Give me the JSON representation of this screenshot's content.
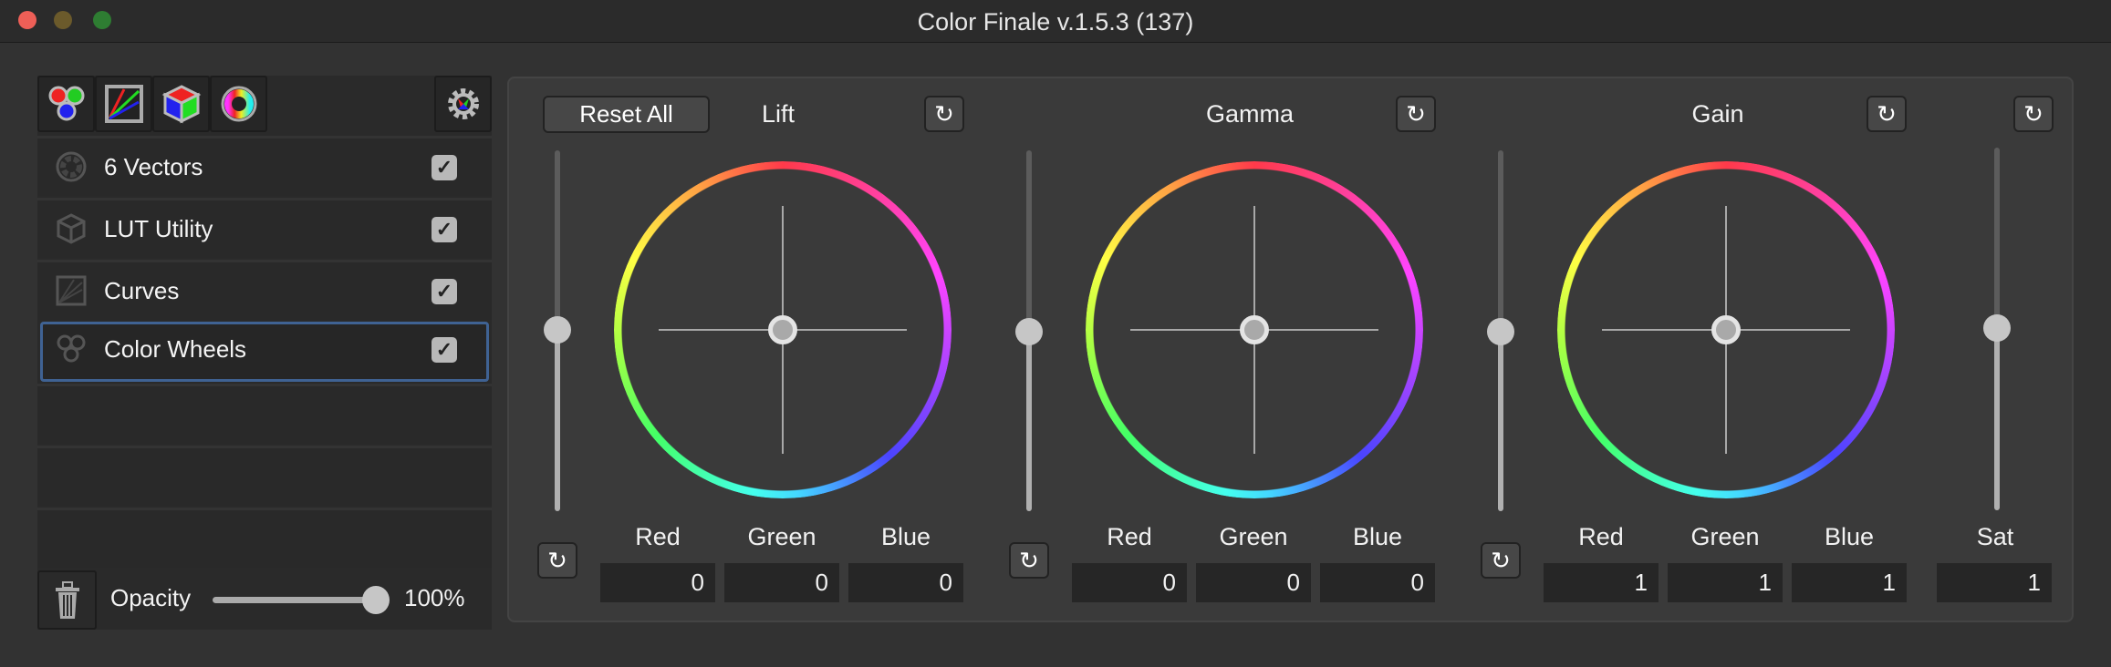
{
  "window": {
    "title": "Color Finale v.1.5.3 (137)",
    "traffic_lights": [
      "#ee5f57",
      "#6b5a2b",
      "#2e7d32"
    ]
  },
  "toolbar": {
    "buttons": [
      "color-wheels",
      "curves",
      "lut",
      "six-vectors"
    ],
    "settings": "settings"
  },
  "sidebar": {
    "items": [
      {
        "label": "6 Vectors",
        "checked": true
      },
      {
        "label": "LUT Utility",
        "checked": true
      },
      {
        "label": "Curves",
        "checked": true
      },
      {
        "label": "Color Wheels",
        "checked": true,
        "selected": true
      }
    ],
    "check_glyph": "✓"
  },
  "opacity": {
    "label": "Opacity",
    "value_text": "100%",
    "value": 1.0
  },
  "panel": {
    "reset_all": "Reset All",
    "reset_glyph": "↻",
    "wheels": [
      {
        "name": "Lift",
        "labels": [
          "Red",
          "Green",
          "Blue"
        ],
        "values": [
          "0",
          "0",
          "0"
        ],
        "luma": 0.5
      },
      {
        "name": "Gamma",
        "labels": [
          "Red",
          "Green",
          "Blue"
        ],
        "values": [
          "0",
          "0",
          "0"
        ],
        "luma": 0.5
      },
      {
        "name": "Gain",
        "labels": [
          "Red",
          "Green",
          "Blue"
        ],
        "values": [
          "1",
          "1",
          "1"
        ],
        "luma": 0.5
      }
    ],
    "sat": {
      "label": "Sat",
      "value": "1",
      "level": 0.5
    }
  }
}
